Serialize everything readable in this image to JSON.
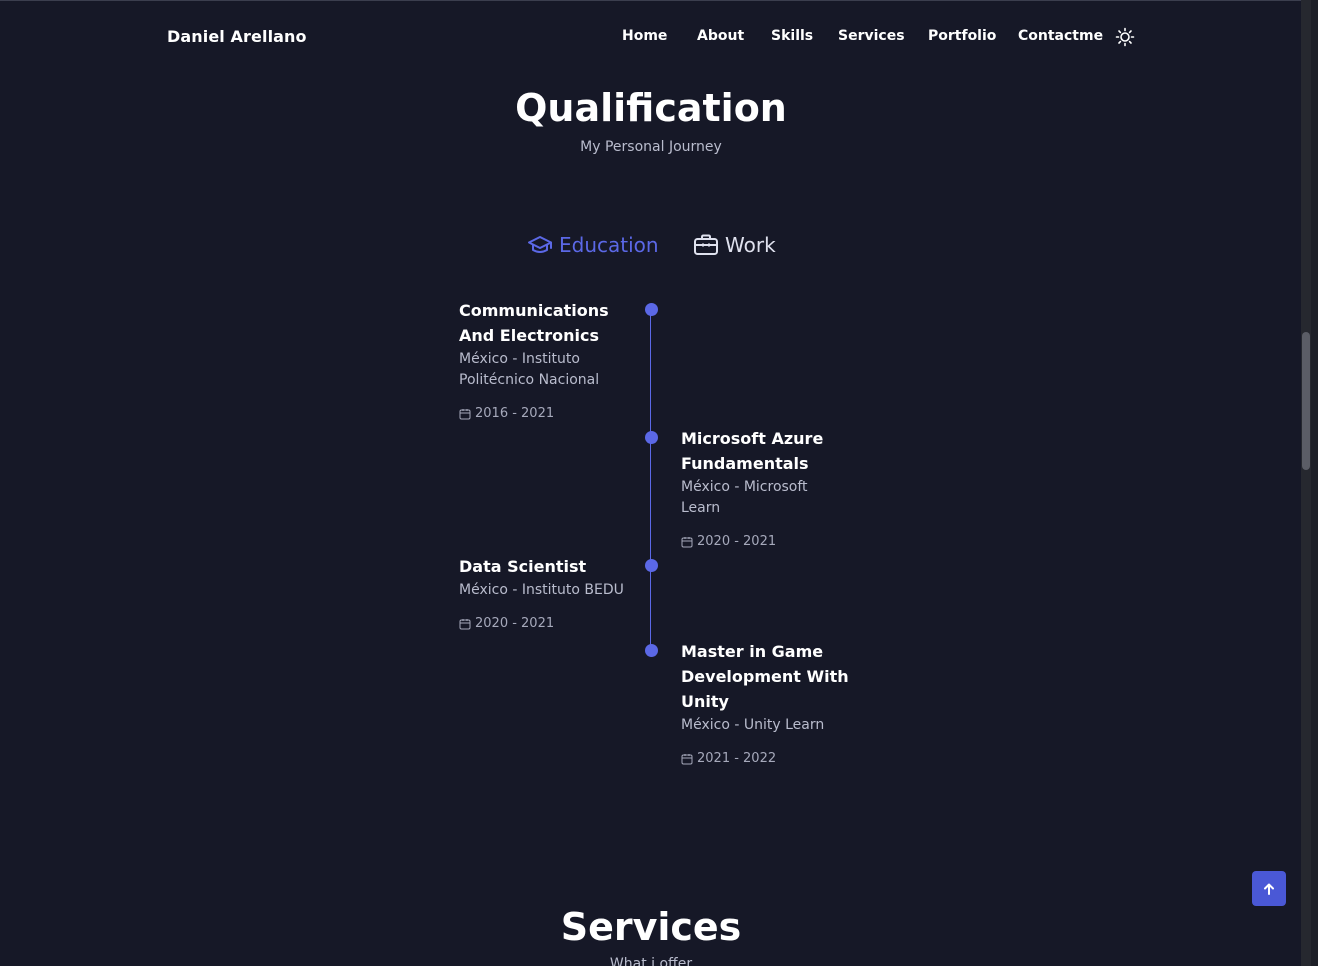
{
  "header": {
    "logo": "Daniel Arellano",
    "nav": [
      "Home",
      "About",
      "Skills",
      "Services",
      "Portfolio",
      "Contactme"
    ],
    "theme_icon": "sun-icon"
  },
  "qualification": {
    "title": "Qualification",
    "subtitle": "My Personal Journey",
    "tabs": [
      {
        "label": "Education",
        "icon": "graduation-cap-icon",
        "active": true
      },
      {
        "label": "Work",
        "icon": "briefcase-icon",
        "active": false
      }
    ],
    "items": [
      {
        "title_lines": [
          "Communications",
          "And Electronics"
        ],
        "sub_lines": [
          "México - Instituto",
          "Politécnico Nacional"
        ],
        "date": "2016 - 2021",
        "side": "left"
      },
      {
        "title_lines": [
          "Microsoft Azure",
          "Fundamentals"
        ],
        "sub_lines": [
          "México - Microsoft",
          "Learn"
        ],
        "date": "2020 - 2021",
        "side": "right"
      },
      {
        "title_lines": [
          "Data Scientist"
        ],
        "sub_lines": [
          "México - Instituto BEDU"
        ],
        "date": "2020 - 2021",
        "side": "left"
      },
      {
        "title_lines": [
          "Master in Game",
          "Development With",
          "Unity"
        ],
        "sub_lines": [
          "México - Unity Learn"
        ],
        "date": "2021 - 2022",
        "side": "right"
      }
    ]
  },
  "services": {
    "title": "Services",
    "subtitle": "What i offer"
  },
  "scroll_up_icon": "arrow-up-icon",
  "colors": {
    "background": "#161827",
    "accent": "#5b68e6",
    "button": "#4a58d6",
    "text_secondary": "#b9bccd"
  }
}
